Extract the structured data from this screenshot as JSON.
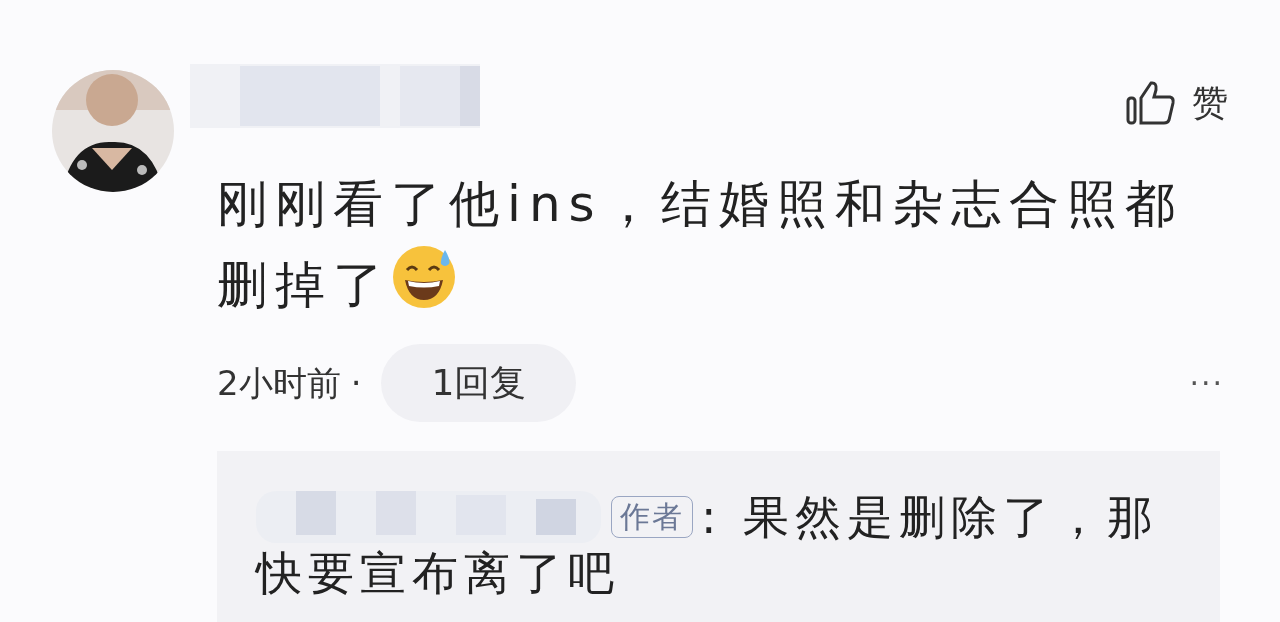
{
  "comment": {
    "like": {
      "label": "赞"
    },
    "text": "刚刚看了他ins，结婚照和杂志合照都删掉了",
    "time": "2小时前",
    "separator": "·",
    "replies_button": "1回复",
    "more": "···"
  },
  "reply": {
    "author_tag": "作者",
    "text": ": 果然是删除了，那快要宣布离了吧"
  }
}
